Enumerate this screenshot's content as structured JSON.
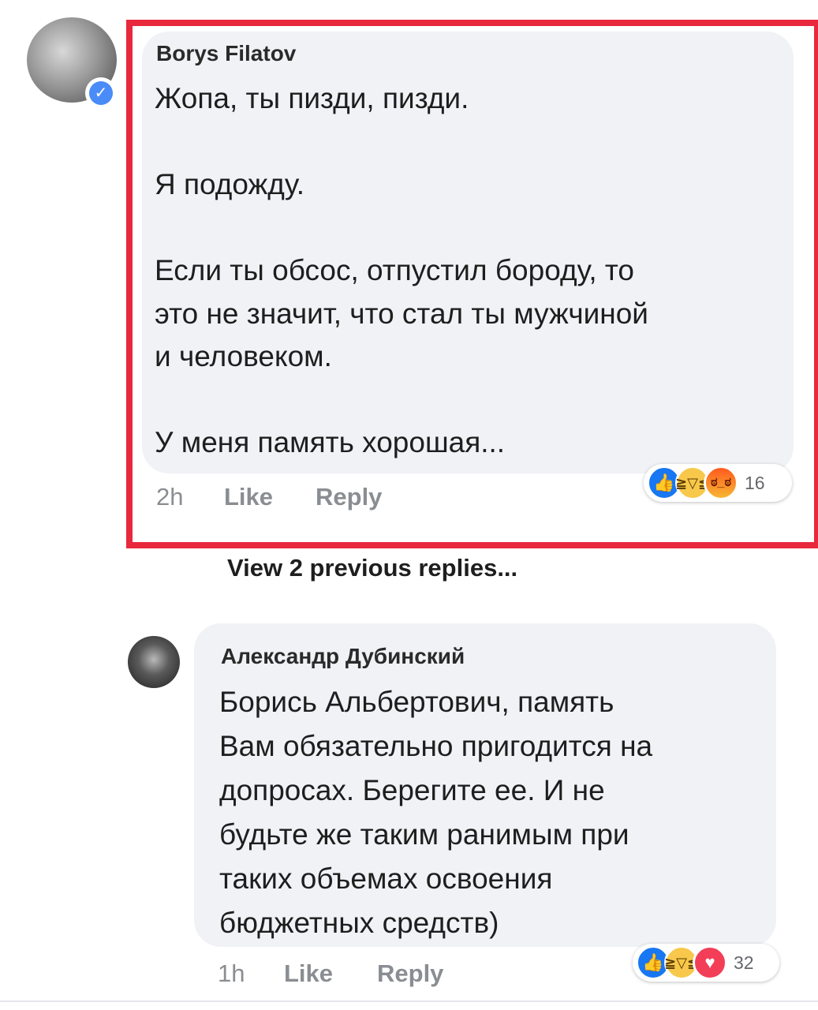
{
  "comment_1": {
    "author": "Borys Filatov",
    "text": "Жопа, ты пизди, пизди.\n\nЯ подожду.\n\nЕсли ты обсос, отпустил бороду, то\nэто не значит, что стал ты мужчиной\nи человеком.\n\nУ меня память хорошая...",
    "time": "2h",
    "like_label": "Like",
    "reply_label": "Reply",
    "reactions": [
      "like-icon",
      "haha-icon",
      "angry-icon"
    ],
    "reaction_count": "16",
    "verified": true,
    "highlight_color": "#e8283c"
  },
  "view_previous_replies": "View 2 previous replies...",
  "comment_2": {
    "author": "Александр Дубинский",
    "text": "Борись Альбертович, память\nВам обязательно пригодится на\nдопросах. Берегите ее. И не\nбудьте же таким ранимым при\nтаких объемах освоения\nбюджетных средств)",
    "time": "1h",
    "like_label": "Like",
    "reply_label": "Reply",
    "reactions": [
      "like-icon",
      "haha-icon",
      "love-icon"
    ],
    "reaction_count": "32"
  },
  "colors": {
    "bubble": "#f0f2f5",
    "like_blue": "#1877f2",
    "meta_gray": "#8a8d91"
  }
}
